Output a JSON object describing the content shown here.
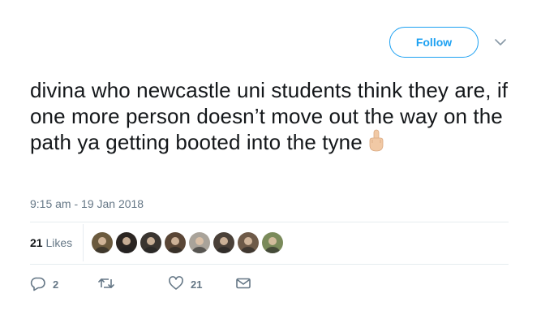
{
  "header": {
    "follow_label": "Follow"
  },
  "tweet": {
    "text": "divina who newcastle uni students think they are, if one more person doesn’t move out the way on the path ya getting booted into the tyne",
    "emoji": "middle-finger-emoji",
    "timestamp": "9:15 am - 19 Jan 2018"
  },
  "stats": {
    "likes_count": "21",
    "likes_label": "Likes"
  },
  "avatars": [
    {
      "name": "avatar-1",
      "color": "#6b5a3e"
    },
    {
      "name": "avatar-2",
      "color": "#2b2522"
    },
    {
      "name": "avatar-3",
      "color": "#3a3530"
    },
    {
      "name": "avatar-4",
      "color": "#5a4636"
    },
    {
      "name": "avatar-5",
      "color": "#a9a39a"
    },
    {
      "name": "avatar-6",
      "color": "#4a4038"
    },
    {
      "name": "avatar-7",
      "color": "#6e5a48"
    },
    {
      "name": "avatar-8",
      "color": "#7a8a5a"
    }
  ],
  "actions": {
    "reply_count": "2",
    "retweet_count": "",
    "like_count": "21"
  },
  "colors": {
    "brand": "#1da1f2",
    "text": "#14171a",
    "muted": "#657786",
    "border": "#e6ecf0"
  }
}
